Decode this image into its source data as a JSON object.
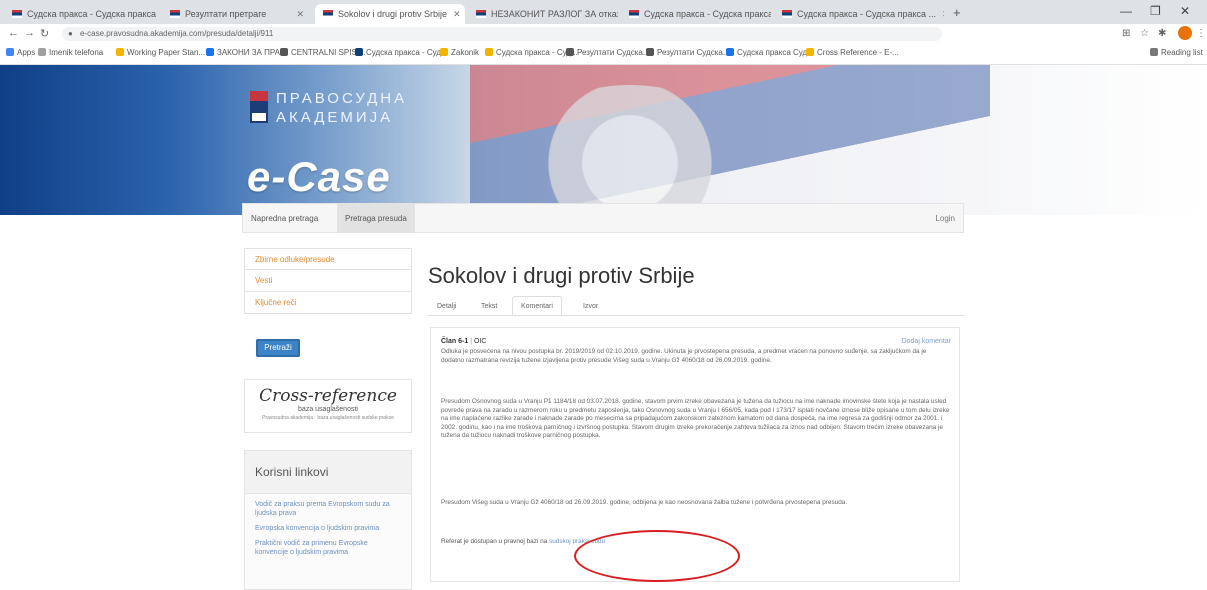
{
  "browser": {
    "tabs": [
      {
        "title": "Судска пракса - Судска пракса ..."
      },
      {
        "title": "Резултати претраге"
      },
      {
        "title": "Sokolov i drugi protiv Srbije"
      },
      {
        "title": "НЕЗАКОНИТ РАЗЛОГ ЗА отказ ..."
      },
      {
        "title": "Судска пракса - Судска пракса ..."
      },
      {
        "title": "Судска пракса - Судска пракса ..."
      }
    ],
    "new_tab": "+",
    "url": "e-case.pravosudna.akademija.com/presuda/detalji/911",
    "bookmarks": [
      "Apps",
      "Imenik telefona",
      "Working Paper Stan...",
      "ЗАКОНИ ЗА ПРА...",
      "CENTRALNI SPISI...",
      "Судска пракса - Суд...",
      "Zakonik",
      "Судска пракса - Суд...",
      "Резултати Судска...",
      "Резултати Судска...",
      "Судска пракса Суд...",
      "Cross Reference - E-...",
      "Reading list"
    ],
    "window_controls": {
      "minimize": "—",
      "restore": "❐",
      "close": "✕"
    }
  },
  "site": {
    "logo_line1": "ПРАВОСУДНА",
    "logo_line2": "АКАДЕМИЈА",
    "brand": "e-Case",
    "nav": [
      "Napredna pretraga",
      "Pretraga presuda"
    ],
    "login": "Login"
  },
  "sidebar": {
    "links": [
      "Zbirne odluke/presude",
      "Vesti",
      "Ključne reči"
    ],
    "search_button": "Pretraži",
    "crossref_title": "Cross-reference",
    "crossref_subtitle": "baza usaglašenosti",
    "crossref_caption": "Pravosudna akademija · baza usaglašenosti sudske prakse",
    "useful_title": "Korisni linkovi",
    "useful_links": [
      "Vodič za praksu prema Evropskom sudu za ljudska prava",
      "Evropska konvencija o ljudskim pravima",
      "Praktični vodič za primenu Evropske konvencije o ljudskim pravima"
    ]
  },
  "main": {
    "title": "Sokolov i drugi protiv Srbije",
    "tabs": [
      "Detalji",
      "Tekst",
      "Komentari",
      "Izvor"
    ],
    "selected_tab": "Komentari",
    "comment": {
      "article": "Član 6-1",
      "sep": "|",
      "type": "OIC",
      "link": "Dodaj komentar",
      "p1": "Odluka je posvećena na nivou postupka br. 2019/2019 od 02.10.2019. godine. Ukinuta je prvostepena presuda, a predmet vraćen na ponovno suđenje, sa zaključkom da je dodatno razmatrana revizija tužene izjavljena protiv presude Višeg suda u Vranju Gž 4060/18 od 26.09.2019. godine.",
      "p2": "Presudom Osnovnog suda u Vranju P1 1184/18 od 03.07.2018. godine, stavom prvim izreke obavezana je tužena da tužiocu na ime naknade imovinske štete koja je nastala usled povrede prava na zaradu u razmerom roku u predmetu zaposlenja, tako Osnovnog suda u Vranju I 656/05, kada pod I 173/17 isplati novčane iznose bliže opisane u tom delu izreke na ime naplaćene razlike zarade i naknade zarade po mesecima sa pripadajućom zakonskom zateznom kamatom od dana dospeća, na ime regresa za godišnji odmor za 2001. i 2002. godinu, kao i na ime troškova parničnog i izvršnog postupka. Stavom drugim izreke prekoračenje zahteva tužilaca za iznos nad odbijen. Stavom trećim izreke obavezana je tužena da tužiocu naknadi troškove parničnog postupka.",
      "p3": "Presudom Višeg suda u Vranju Gž 4060/18 od 26.09.2019. godine, odbijena je kao neosnovana žalba tužene i potvrđena prvostepena presuda.",
      "p4_prefix": "Referat je dostupan u pravnoj bazi na",
      "p4_link": "sudskoj praksi sudu"
    }
  }
}
